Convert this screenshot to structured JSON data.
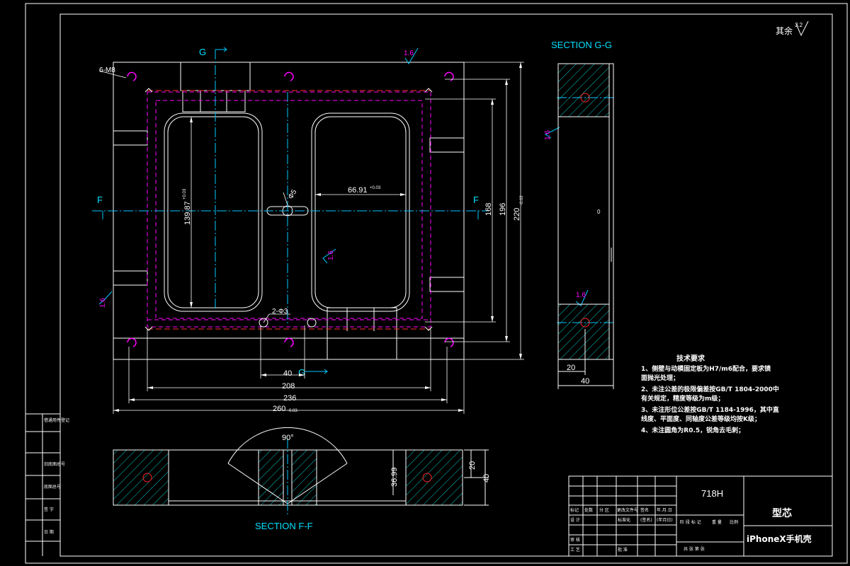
{
  "view_labels": {
    "section_gg": "SECTION G-G",
    "section_ff": "SECTION F-F",
    "g": "G",
    "f": "F"
  },
  "roughness": {
    "corner_label": "其余",
    "corner_value": "3.2",
    "top": "1.6",
    "left_side": "1.6",
    "center": "1.6",
    "gg_left": "1.6",
    "gg_mid": "1.6"
  },
  "callouts": {
    "six_m8": "6-M8",
    "two_phi3": "2-Φ3",
    "phi5": "Φ5"
  },
  "dimensions": {
    "width_260": "260",
    "width_260_tol": "-0.03",
    "width_236": "236",
    "width_208": "208",
    "width_40": "40",
    "height_168": "168",
    "height_196": "196",
    "height_220": "220",
    "height_220_tol": "-0.02",
    "cavity_width": "66.91",
    "cavity_width_tol": "+0.03",
    "cavity_height": "139.87",
    "cavity_height_tol": "+0.03",
    "angle_90": "90°",
    "ff_depth": "36.99",
    "ff_20": "20",
    "ff_40": "40",
    "gg_20": "20",
    "gg_40": "40",
    "gg_zero": "0"
  },
  "notes": {
    "title": "技术要求",
    "lines": [
      "1、侧壁与动模固定板为H7/m6配合，要求镜",
      "   面抛光处理；",
      "2、未注公差的极限偏差按GB/T 1804-2000中",
      "   有关规定，精度等级为m级；",
      "3、未注形位公差按GB/T 1184-1996，其中直",
      "   线度、平面度、同轴度公差等级均按K级；",
      "4、未注圆角为R0.5，锐角去毛刺；"
    ]
  },
  "left_strip": [
    "借通用件登记",
    "旧底图总号",
    "底图总号",
    "签 字",
    "日 期"
  ],
  "title_block": {
    "material": "718H",
    "part_name": "型芯",
    "product": "iPhoneX手机壳",
    "header_cells": [
      "标记",
      "处数",
      "分 区",
      "更改文件号",
      "签名",
      "年.月.日"
    ],
    "left_rows": [
      "设 计",
      "审 核",
      "工 艺"
    ],
    "stage_labels": "阶 段 标 记",
    "weight": "重 量",
    "scale": "比例",
    "std_label": "标准化",
    "sign_label": "(签名)",
    "date_label": "(年月日)",
    "approve": "批 准",
    "sheets": "共 张 第 张"
  },
  "colors": {
    "background": "#000000",
    "outline": "#ffffff",
    "dimension": "#ffffff",
    "centerline": "#00c8ff",
    "hidden_magenta": "#ff00ff",
    "roughness_symbol": "#00c8ff",
    "hole": "#ff2020",
    "hatch": "#00c8c8",
    "label_cyan": "#00e0ff"
  }
}
